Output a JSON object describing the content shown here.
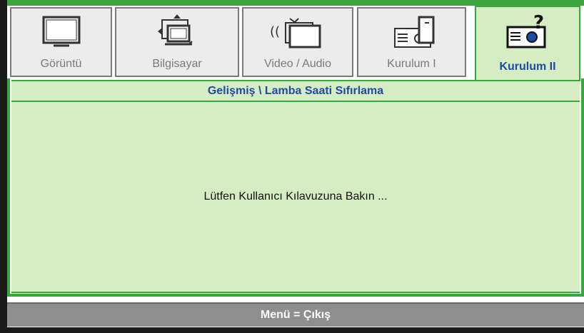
{
  "tabs": [
    {
      "label": "Görüntü",
      "icon": "monitor-icon",
      "active": false
    },
    {
      "label": "Bilgisayar",
      "icon": "computer-icon",
      "active": false
    },
    {
      "label": "Video / Audio",
      "icon": "video-audio-icon",
      "active": false
    },
    {
      "label": "Kurulum I",
      "icon": "projector-setup-icon",
      "active": false
    },
    {
      "label": "Kurulum II",
      "icon": "projector-help-icon",
      "active": true
    }
  ],
  "breadcrumb": "Gelişmiş \\ Lamba Saati Sıfırlama",
  "message": "Lütfen Kullanıcı Kılavuzuna Bakın ...",
  "footer": "Menü = Çıkış",
  "colors": {
    "accent_green": "#3ea63e",
    "panel_green": "#d6ecc2",
    "active_text": "#1e4aa8",
    "inactive_text": "#7a7a7a",
    "footer_bg": "#8e8e8e"
  }
}
